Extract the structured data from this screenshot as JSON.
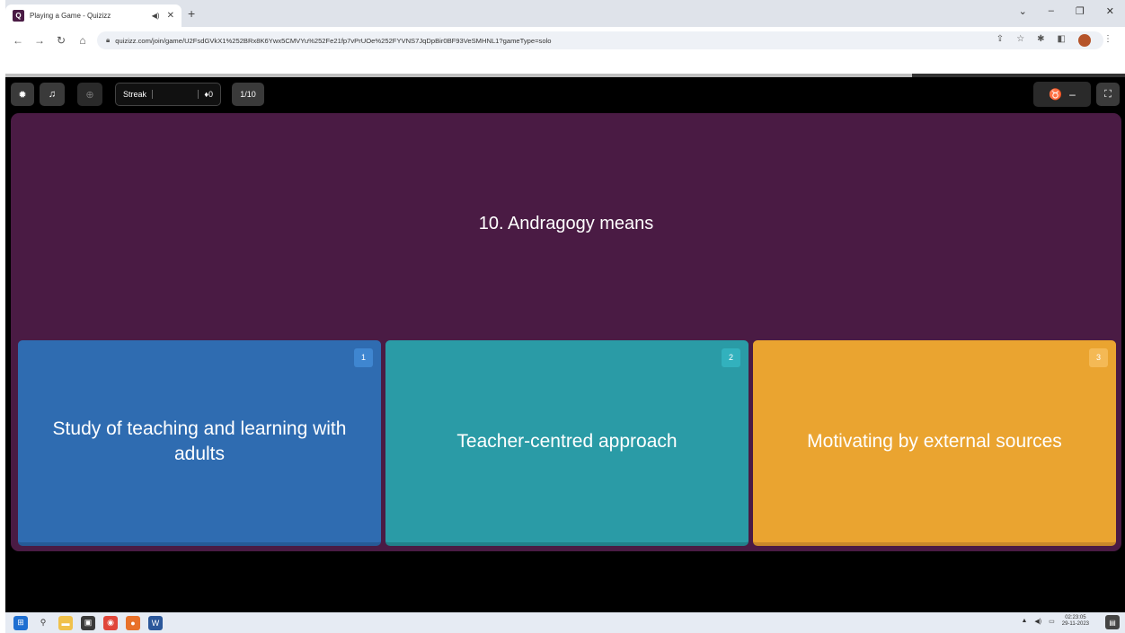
{
  "browser": {
    "tab_title": "Playing a Game - Quizizz",
    "url": "quizizz.com/join/game/U2FsdGVkX1%252BRx8K6Ywx5CMVYu%252Fe21fp7vPrUOe%252FYVNS7JqDpBir0BF93VeSMHNL1?gameType=solo"
  },
  "toolbar": {
    "streak_label": "Streak",
    "streak_count": "0",
    "question_counter": "1/10",
    "powerup_value": "–"
  },
  "progress": {
    "fraction": 0.81
  },
  "question": {
    "text": "10. Andragogy means"
  },
  "options": [
    {
      "number": "1",
      "text": "Study of teaching and learning with adults"
    },
    {
      "number": "2",
      "text": "Teacher-centred approach"
    },
    {
      "number": "3",
      "text": "Motivating by external sources"
    }
  ],
  "taskbar": {
    "time": "02:23:05",
    "date": "29-11-2023"
  },
  "colors": {
    "panel": "#4a1b44",
    "option1": "#2f6cb1",
    "option2": "#2a9ba6",
    "option3": "#eaa430"
  }
}
